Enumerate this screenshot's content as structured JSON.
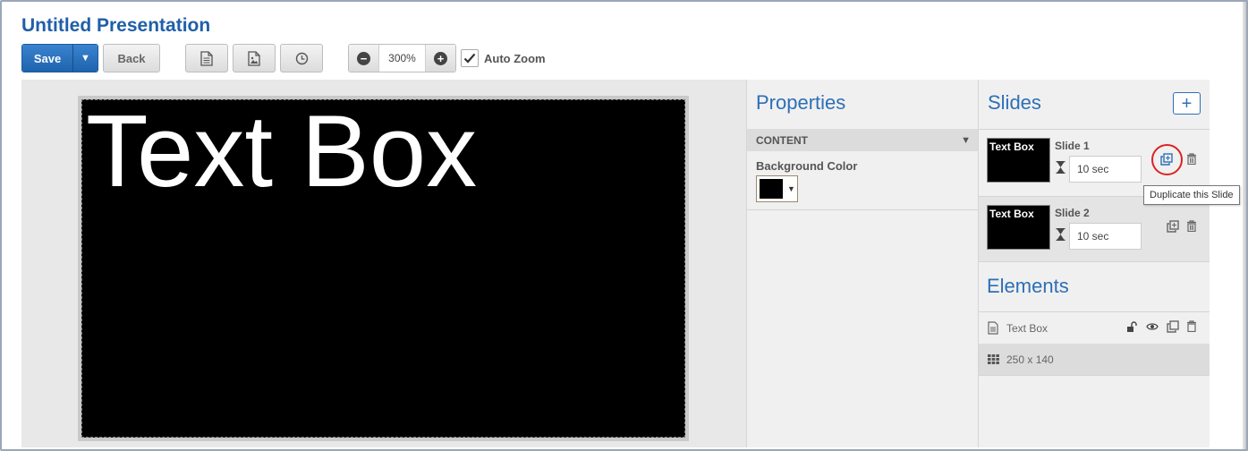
{
  "app": {
    "title": "Untitled Presentation"
  },
  "toolbar": {
    "save_label": "Save",
    "back_label": "Back",
    "zoom_value": "300%",
    "auto_zoom_label": "Auto Zoom",
    "auto_zoom_checked": true
  },
  "canvas": {
    "text_box_content": "Text Box",
    "background_color": "#000000"
  },
  "properties": {
    "title": "Properties",
    "section_label": "CONTENT",
    "background_color_label": "Background Color"
  },
  "slides": {
    "title": "Slides",
    "add_icon": "+",
    "items": [
      {
        "name": "Slide 1",
        "thumb_text": "Text Box",
        "duration": "10 sec"
      },
      {
        "name": "Slide 2",
        "thumb_text": "Text Box",
        "duration": "10 sec"
      }
    ],
    "duplicate_tooltip": "Duplicate this Slide"
  },
  "elements": {
    "title": "Elements",
    "items": [
      {
        "label": "Text Box",
        "size": "250 x 140"
      }
    ]
  },
  "colors": {
    "accent": "#2d6fb7",
    "save_button": "#1e63ad",
    "highlight_ring": "#dd2222"
  },
  "icons": [
    "caret-down-icon",
    "document-icon",
    "image-icon",
    "clock-icon",
    "zoom-out-icon",
    "zoom-in-icon",
    "checkmark-icon",
    "hourglass-icon",
    "duplicate-icon",
    "trash-icon",
    "unlock-icon",
    "eye-icon",
    "grid-icon"
  ]
}
